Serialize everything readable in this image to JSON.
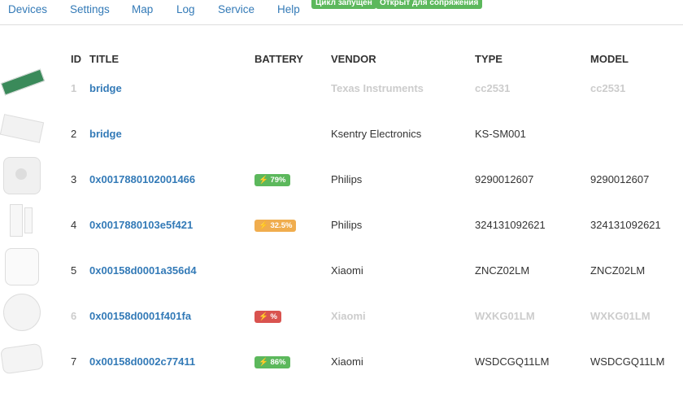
{
  "nav": {
    "items": [
      "Devices",
      "Settings",
      "Map",
      "Log",
      "Service",
      "Help"
    ],
    "badges": [
      "Цикл запущен",
      "Открыт для сопряжения"
    ]
  },
  "colors": {
    "link": "#337ab7",
    "success": "#5cb85c",
    "warning": "#f0ad4e",
    "danger": "#d9534f"
  },
  "table": {
    "headers": [
      "ID",
      "TITLE",
      "BATTERY",
      "VENDOR",
      "TYPE",
      "MODEL"
    ],
    "rows": [
      {
        "id": "1",
        "title": "bridge",
        "battery": "",
        "vendor": "Texas Instruments",
        "type": "cc2531",
        "model": "cc2531",
        "disabled": true,
        "image": "usb-stick"
      },
      {
        "id": "2",
        "title": "bridge",
        "battery": "",
        "vendor": "Ksentry Electronics",
        "type": "KS-SM001",
        "model": "",
        "disabled": false,
        "image": "relay"
      },
      {
        "id": "3",
        "title": "0x0017880102001466",
        "battery": "79%",
        "battery_icon": "bolt-icon",
        "battery_status": "success",
        "vendor": "Philips",
        "type": "9290012607",
        "model": "9290012607",
        "disabled": false,
        "image": "motion-sensor"
      },
      {
        "id": "4",
        "title": "0x0017880103e5f421",
        "battery": "32.5%",
        "battery_icon": "bolt-icon",
        "battery_status": "warning",
        "vendor": "Philips",
        "type": "324131092621",
        "model": "324131092621",
        "disabled": false,
        "image": "dimmer-switch"
      },
      {
        "id": "5",
        "title": "0x00158d0001a356d4",
        "battery": "",
        "vendor": "Xiaomi",
        "type": "ZNCZ02LM",
        "model": "ZNCZ02LM",
        "disabled": false,
        "image": "smart-plug"
      },
      {
        "id": "6",
        "title": "0x00158d0001f401fa",
        "battery": "%",
        "battery_icon": "bolt-icon",
        "battery_status": "danger",
        "vendor": "Xiaomi",
        "type": "WXKG01LM",
        "model": "WXKG01LM",
        "disabled": true,
        "image": "round-button"
      },
      {
        "id": "7",
        "title": "0x00158d0002c77411",
        "battery": "86%",
        "battery_icon": "bolt-icon",
        "battery_status": "success",
        "vendor": "Xiaomi",
        "type": "WSDCGQ11LM",
        "model": "WSDCGQ11LM",
        "disabled": false,
        "image": "temp-sensor"
      }
    ]
  }
}
